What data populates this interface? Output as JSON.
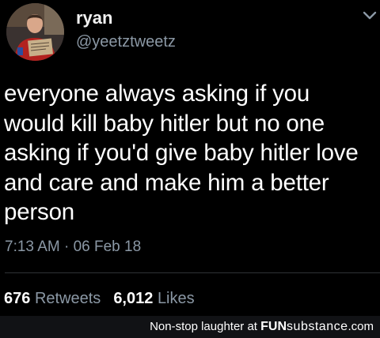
{
  "user": {
    "display_name": "ryan",
    "handle": "@yeetztweetz",
    "avatar_icon": "profile-photo",
    "menu_icon": "chevron-down-icon"
  },
  "tweet": {
    "text": "everyone always asking if you\nwould kill baby hitler but no one\nasking if you'd give baby hitler love\nand care and make him a better\nperson",
    "timestamp": "7:13 AM · 06 Feb 18"
  },
  "stats": {
    "retweets_count": "676",
    "retweets_label": "Retweets",
    "likes_count": "6,012",
    "likes_label": "Likes"
  },
  "footer": {
    "caption": "Non-stop laughter at ",
    "brand_part1": "FUN",
    "brand_part2": "substance",
    "brand_suffix": ".com"
  },
  "colors": {
    "background": "#000000",
    "text_primary": "#ffffff",
    "text_secondary": "#8b98a5",
    "footer_bg": "#111215"
  }
}
